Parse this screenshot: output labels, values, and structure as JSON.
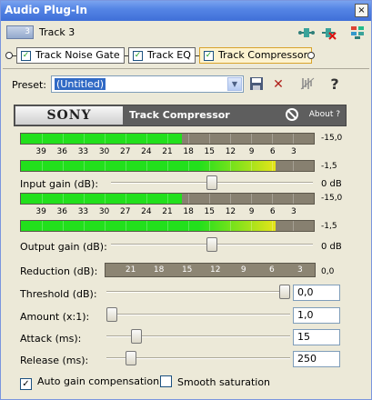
{
  "window": {
    "title": "Audio Plug-In",
    "close_glyph": "×"
  },
  "track": {
    "number": "3",
    "name": "Track 3"
  },
  "toolbar": {
    "icons": [
      "insert-plugin-icon",
      "remove-plugin-icon",
      "plugin-chain-icon"
    ]
  },
  "chain": {
    "plugins": [
      {
        "label": "Track Noise Gate",
        "checked": true,
        "active": false
      },
      {
        "label": "Track EQ",
        "checked": true,
        "active": false
      },
      {
        "label": "Track Compressor",
        "checked": true,
        "active": true
      }
    ]
  },
  "preset": {
    "label": "Preset:",
    "value": "(Untitled)",
    "buttons": [
      "save-preset-icon",
      "delete-preset-icon",
      "bypass-icon",
      "help-icon"
    ],
    "help_glyph": "?"
  },
  "panel": {
    "brand": "SONY",
    "title": "Track Compressor",
    "about": "About  ?"
  },
  "scale_labels": [
    "39",
    "36",
    "33",
    "30",
    "27",
    "24",
    "21",
    "18",
    "15",
    "12",
    "9",
    "6",
    "3"
  ],
  "input_meters": {
    "top_value": "-15,0",
    "bottom_value": "-1,5",
    "top_level_pct": 55,
    "bottom_level_pct": 87
  },
  "input_gain": {
    "label": "Input gain (dB):",
    "value": "0 dB",
    "position": 0.5
  },
  "output_meters": {
    "top_value": "-15,0",
    "bottom_value": "-1,5",
    "top_level_pct": 55,
    "bottom_level_pct": 87
  },
  "output_gain": {
    "label": "Output gain (dB):",
    "value": "0 dB",
    "position": 0.5
  },
  "reduction": {
    "label": "Reduction (dB):",
    "value": "0,0",
    "scale": [
      "21",
      "18",
      "15",
      "12",
      "9",
      "6",
      "3"
    ]
  },
  "threshold": {
    "label": "Threshold (dB):",
    "value": "0,0",
    "position": 1.0
  },
  "amount": {
    "label": "Amount (x:1):",
    "value": "1,0",
    "position": 0.0
  },
  "attack": {
    "label": "Attack (ms):",
    "value": "15",
    "position": 0.14
  },
  "release": {
    "label": "Release (ms):",
    "value": "250",
    "position": 0.11
  },
  "options": {
    "auto_gain": {
      "label": "Auto gain compensation",
      "checked": true
    },
    "smooth_saturation": {
      "label": "Smooth saturation",
      "checked": false
    }
  },
  "colors": {
    "meter_green": "#22e01c",
    "meter_yellow": "#e6e41a",
    "meter_bg": "#878070",
    "title_blue": "#3f6fd8"
  }
}
